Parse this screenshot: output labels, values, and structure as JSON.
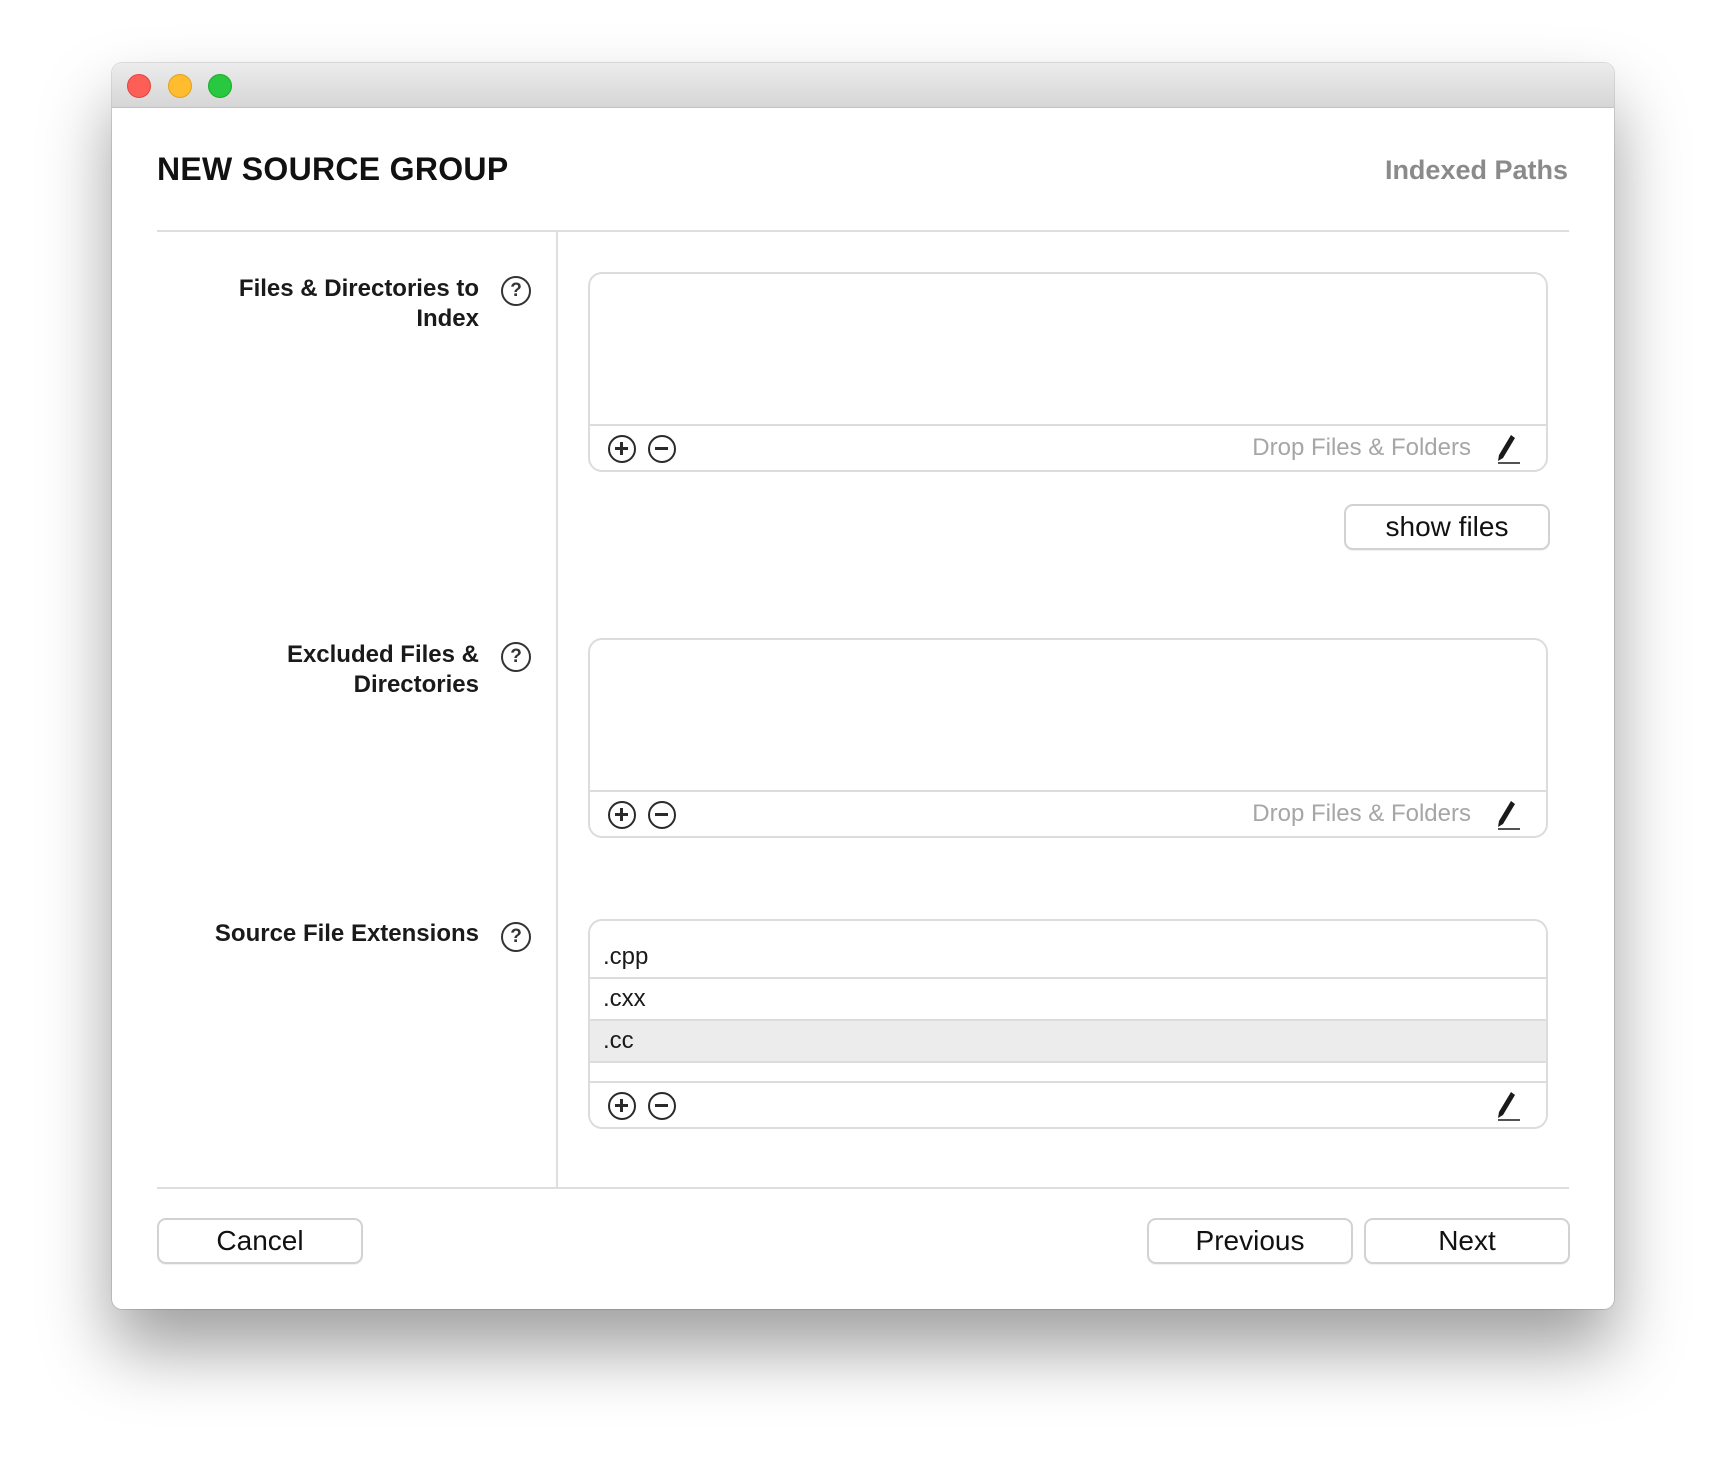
{
  "window": {
    "title": "",
    "controls": [
      "close",
      "minimize",
      "zoom"
    ]
  },
  "header": {
    "title": "NEW SOURCE GROUP",
    "step": "Indexed Paths"
  },
  "fields": {
    "indexed_paths": {
      "label": "Files & Directories to Index",
      "help_icon": "?",
      "items": [],
      "drop_hint": "Drop Files & Folders",
      "show_files_label": "show files"
    },
    "excluded_paths": {
      "label": "Excluded Files & Directories",
      "help_icon": "?",
      "items": [],
      "drop_hint": "Drop Files & Folders"
    },
    "source_extensions": {
      "label": "Source File Extensions",
      "help_icon": "?",
      "items": [
        ".cpp",
        ".cxx",
        ".cc"
      ],
      "selected_item": ".cc"
    }
  },
  "footer": {
    "cancel_label": "Cancel",
    "previous_label": "Previous",
    "next_label": "Next"
  },
  "icons": {
    "add": "plus-circle-icon",
    "remove": "minus-circle-icon",
    "edit": "pencil-icon",
    "help": "question-mark-circle-icon"
  },
  "colors": {
    "close": "#fd5f57",
    "minimize": "#febc2e",
    "zoom": "#28c840",
    "selected_row": "#ececec",
    "hint_text": "#a6a6a6",
    "subtitle_text": "#8a8a8a"
  }
}
